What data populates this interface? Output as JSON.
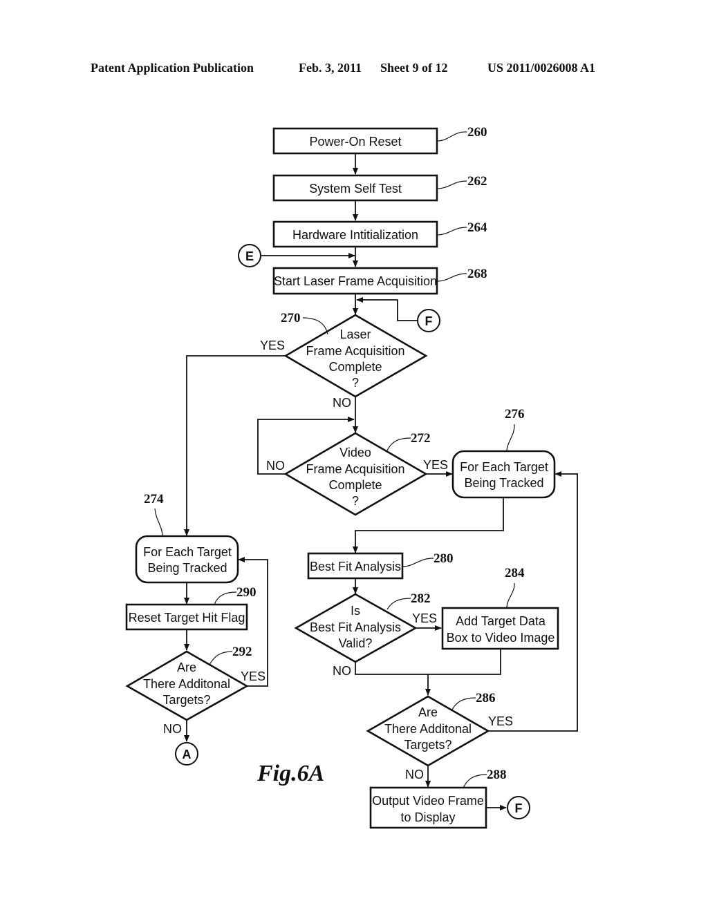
{
  "header": {
    "publication": "Patent Application Publication",
    "date": "Feb. 3, 2011",
    "sheet": "Sheet 9 of 12",
    "number": "US 2011/0026008 A1"
  },
  "figure_label": "Fig.6A",
  "nodes": {
    "n260": {
      "ref": "260",
      "lines": [
        "Power-On Reset"
      ]
    },
    "n262": {
      "ref": "262",
      "lines": [
        "System Self Test"
      ]
    },
    "n264": {
      "ref": "264",
      "lines": [
        "Hardware Intitialization"
      ]
    },
    "n268": {
      "ref": "268",
      "lines": [
        "Start Laser Frame Acquisition"
      ]
    },
    "n270": {
      "ref": "270",
      "lines": [
        "Laser",
        "Frame Acquisition",
        "Complete",
        "?"
      ]
    },
    "n272": {
      "ref": "272",
      "lines": [
        "Video",
        "Frame Acquisition",
        "Complete",
        "?"
      ]
    },
    "n274": {
      "ref": "274",
      "lines": [
        "For Each Target",
        "Being Tracked"
      ]
    },
    "n276": {
      "ref": "276",
      "lines": [
        "For Each Target",
        "Being Tracked"
      ]
    },
    "n280": {
      "ref": "280",
      "lines": [
        "Best Fit Analysis"
      ]
    },
    "n282": {
      "ref": "282",
      "lines": [
        "Is",
        "Best Fit Analysis",
        "Valid?"
      ]
    },
    "n284": {
      "ref": "284",
      "lines": [
        "Add Target Data",
        "Box to Video Image"
      ]
    },
    "n286": {
      "ref": "286",
      "lines": [
        "Are",
        "There Additonal",
        "Targets?"
      ]
    },
    "n288": {
      "ref": "288",
      "lines": [
        "Output Video Frame",
        "to Display"
      ]
    },
    "n290": {
      "ref": "290",
      "lines": [
        "Reset Target Hit Flag"
      ]
    },
    "n292": {
      "ref": "292",
      "lines": [
        "Are",
        "There Additonal",
        "Targets?"
      ]
    }
  },
  "connectors": {
    "e_in": "E",
    "f_in": "F",
    "f_out": "F",
    "a_out": "A"
  },
  "branch_labels": {
    "yes_270": "YES",
    "no_270": "NO",
    "no_272": "NO",
    "yes_272": "YES",
    "yes_282": "YES",
    "no_282": "NO",
    "yes_286": "YES",
    "no_286": "NO",
    "yes_292": "YES",
    "no_292": "NO"
  }
}
